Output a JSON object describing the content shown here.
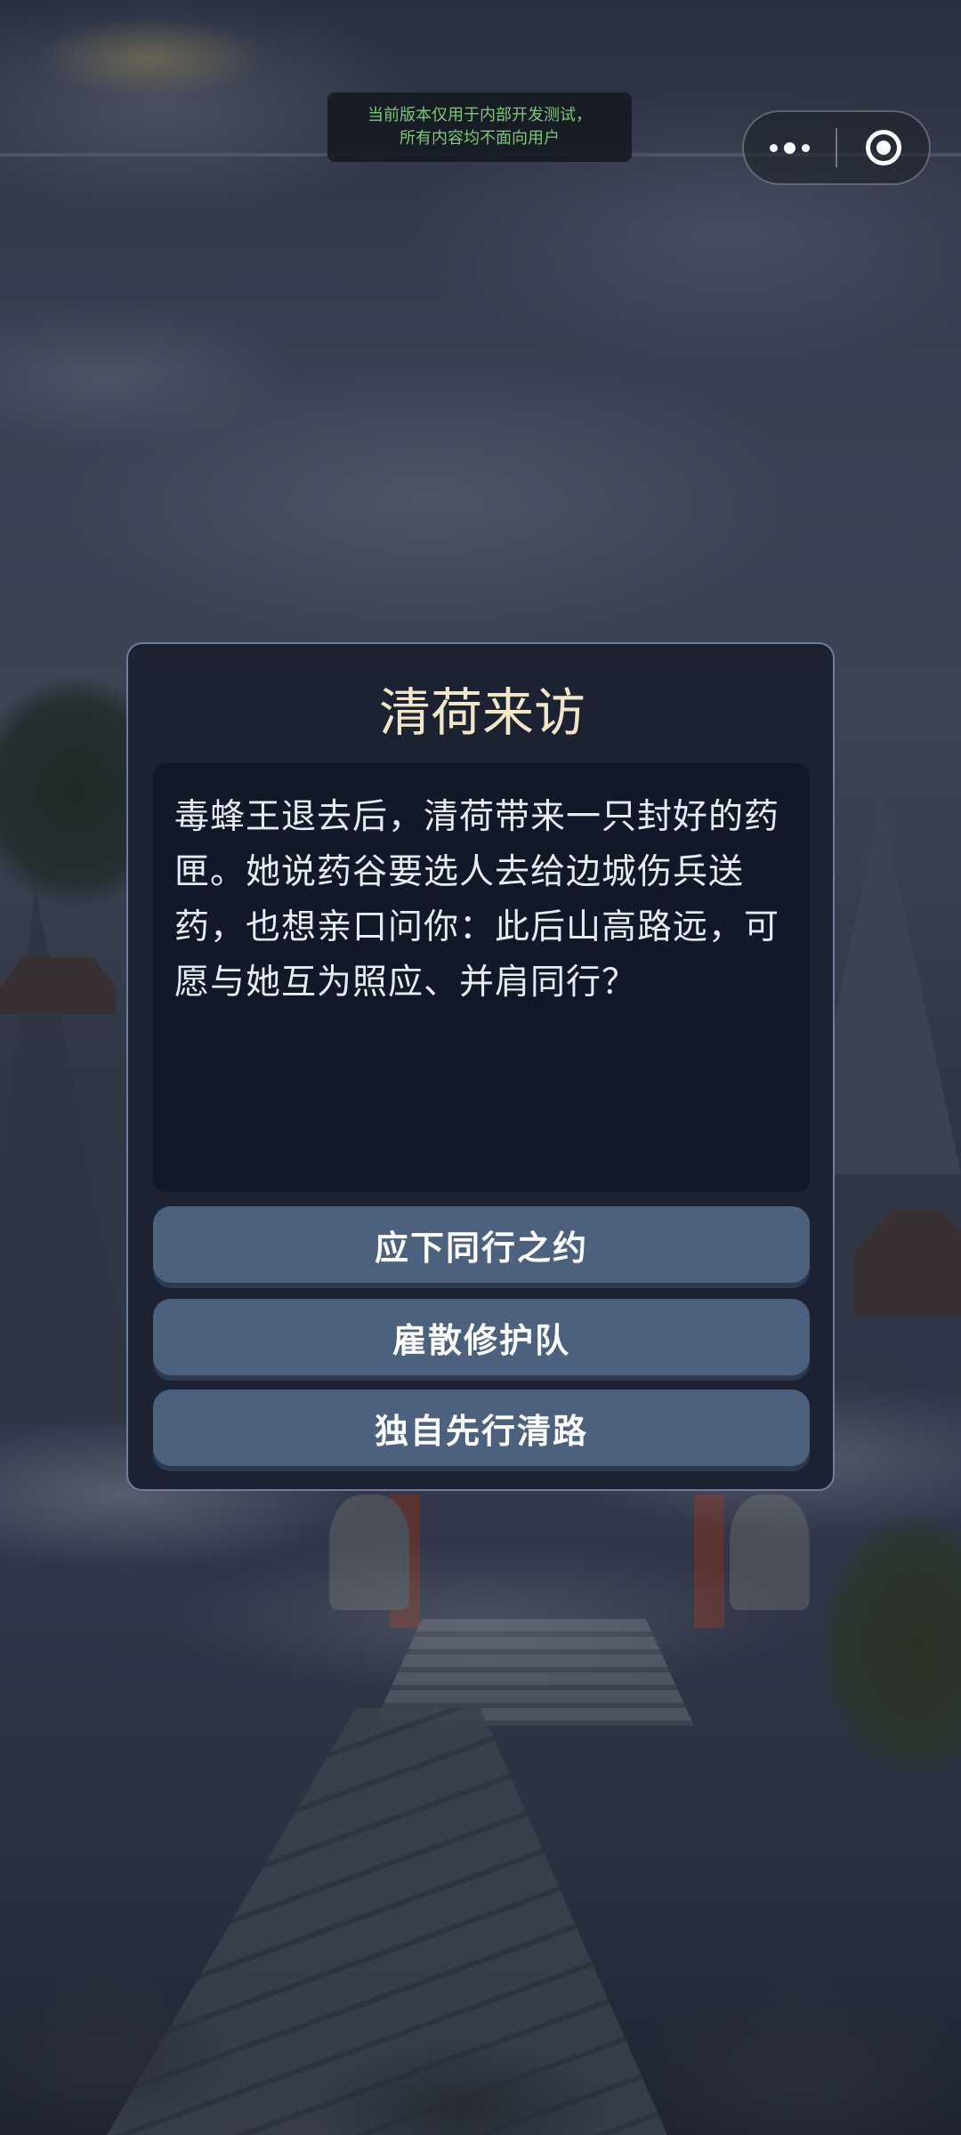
{
  "dev_notice": {
    "line1": "当前版本仅用于内部开发测试，",
    "line2": "所有内容均不面向用户"
  },
  "capsule": {
    "more_icon": "more-dots-icon",
    "close_icon": "target-close-icon"
  },
  "dialog": {
    "title": "清荷来访",
    "body": "毒蜂王退去后，清荷带来一只封好的药匣。她说药谷要选人去给边城伤兵送药，也想亲口问你：此后山高路远，可愿与她互为照应、并肩同行？",
    "choices": [
      {
        "label": "应下同行之约"
      },
      {
        "label": "雇散修护队"
      },
      {
        "label": "独自先行清路"
      }
    ]
  },
  "colors": {
    "title": "#f1e6c7",
    "button": "#4c617d",
    "dialog_bg": "#1c2231",
    "dialog_border": "#6d7f9c",
    "notice_text": "#7ec77a"
  }
}
